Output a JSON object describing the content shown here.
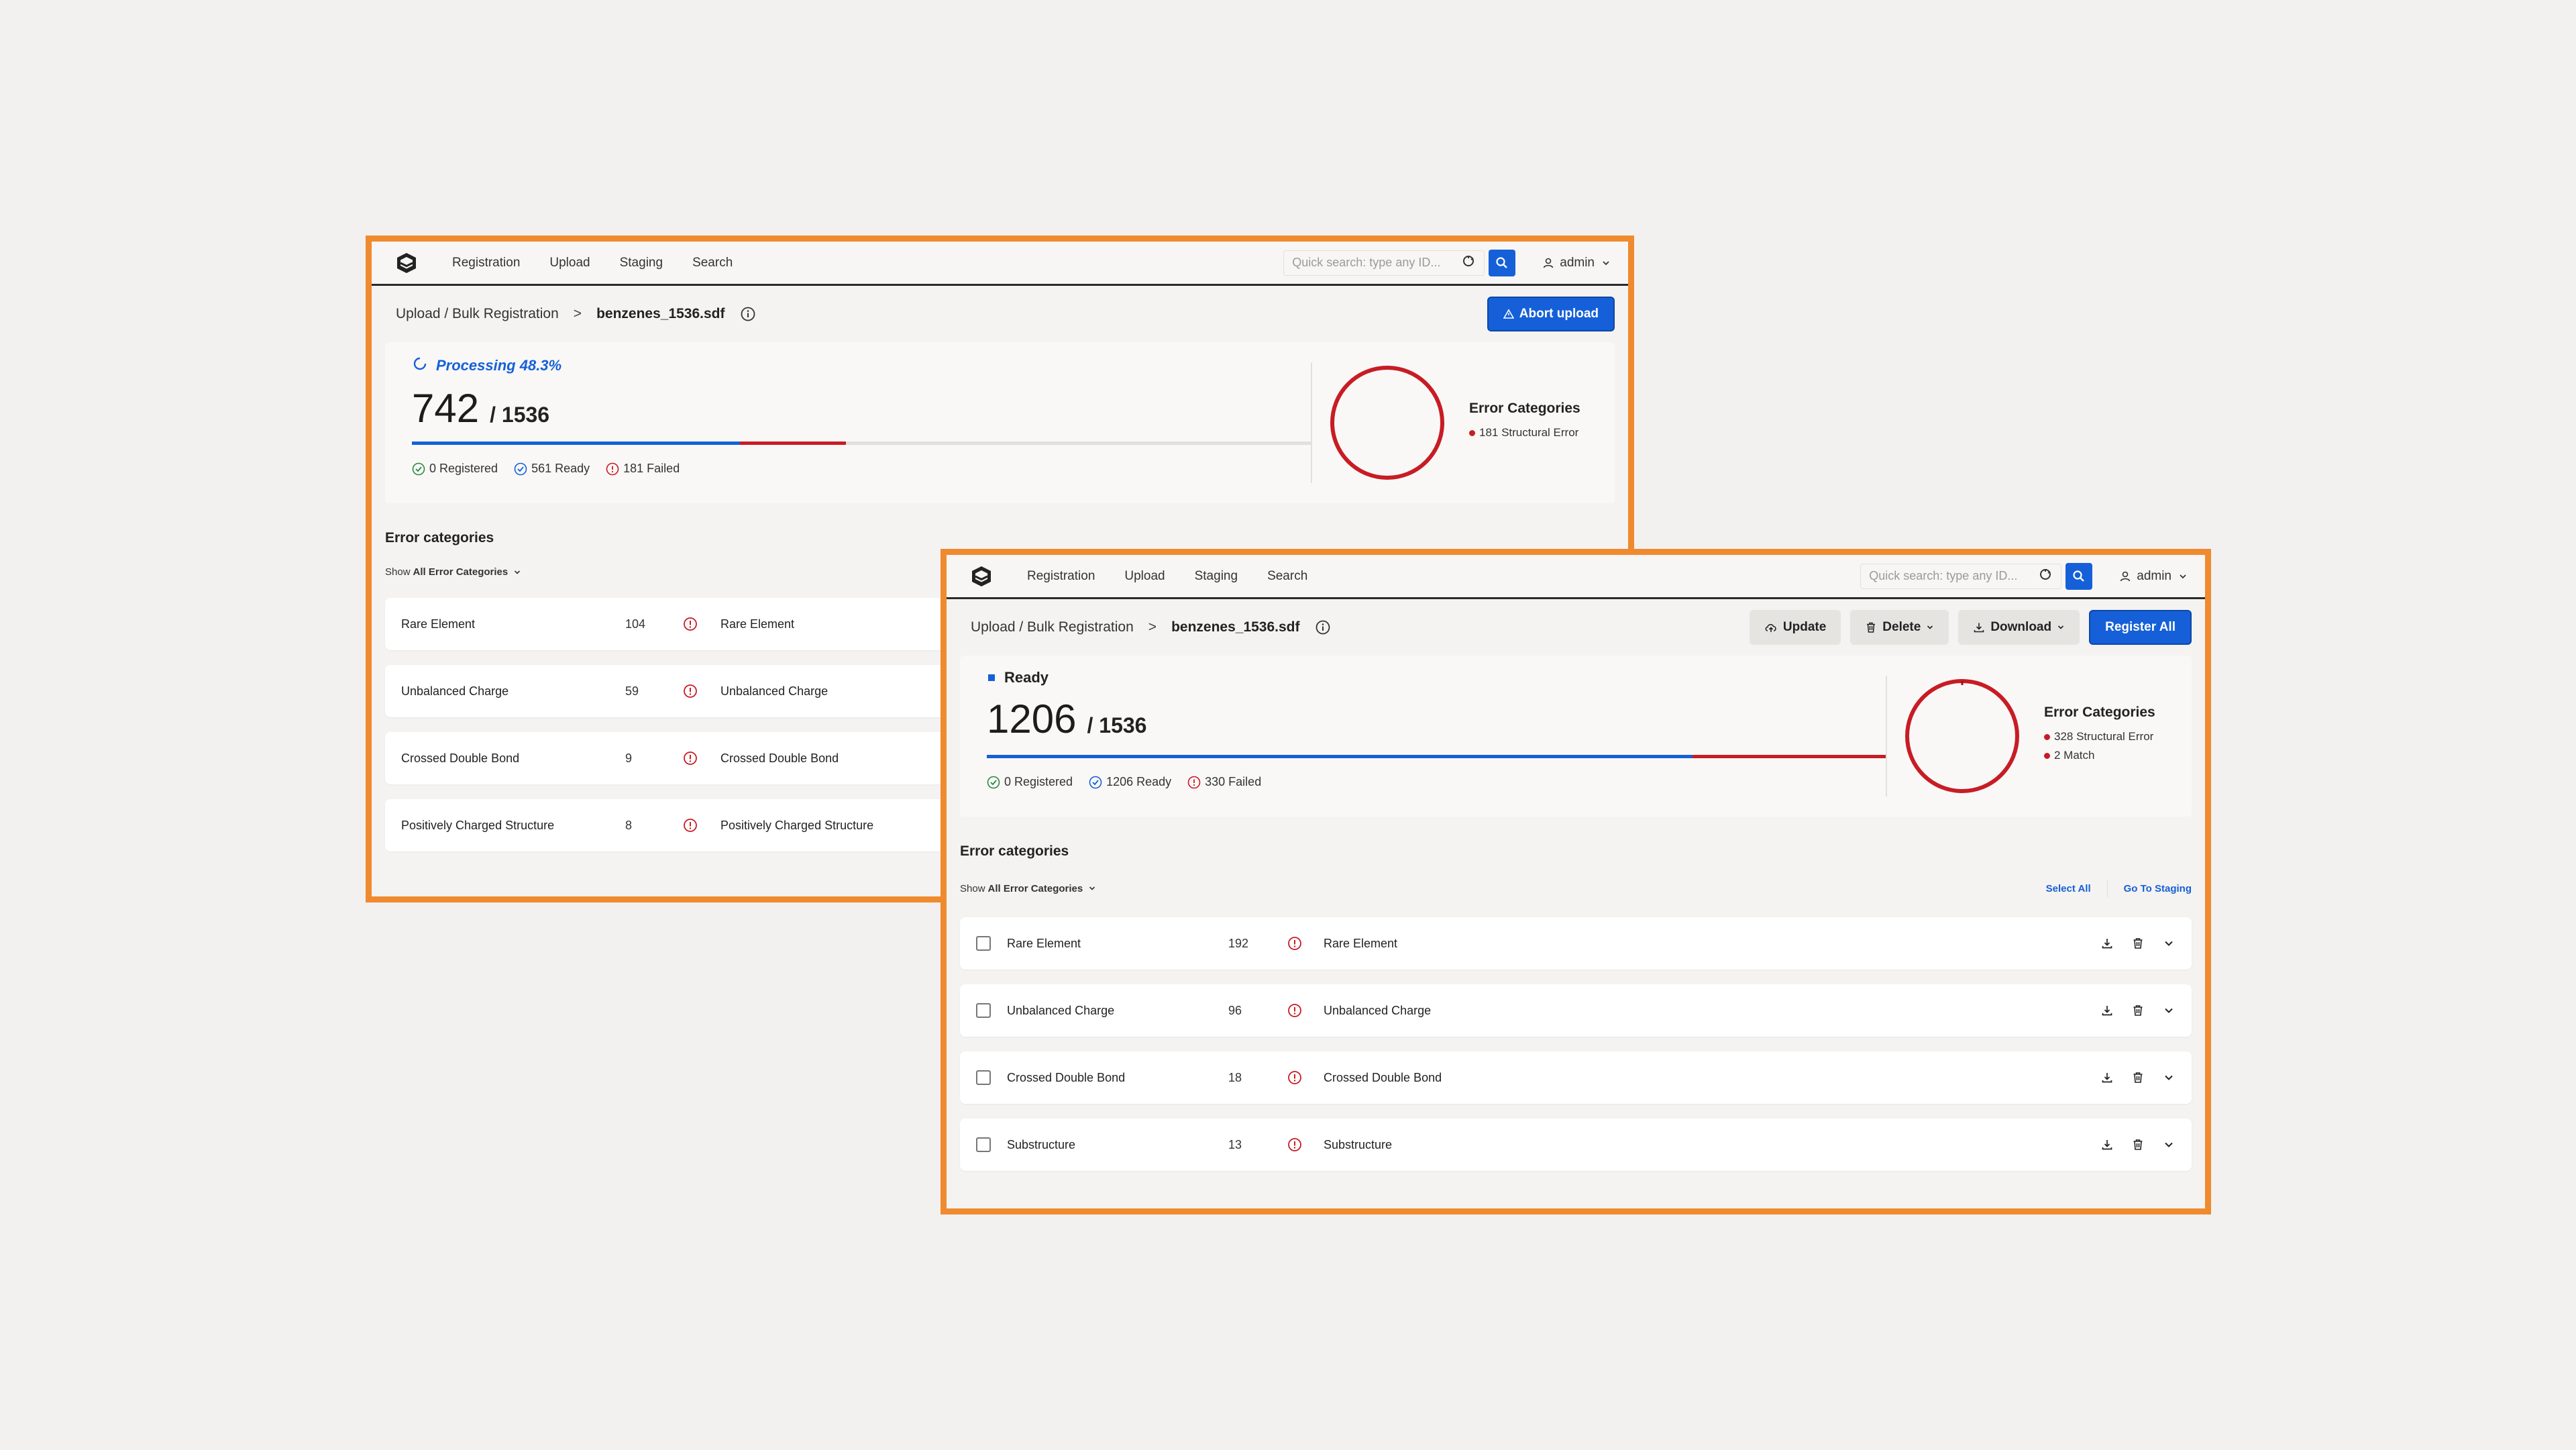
{
  "colors": {
    "accent_orange": "#ef8a2e",
    "primary_blue": "#1560d8",
    "error_red": "#c81c24",
    "success_green": "#2b8a3e",
    "background": "#f3f1ef"
  },
  "screen1": {
    "nav": {
      "items": [
        "Registration",
        "Upload",
        "Staging",
        "Search"
      ],
      "search_placeholder": "Quick search: type any ID...",
      "user": "admin"
    },
    "breadcrumb": {
      "path": "Upload / Bulk Registration",
      "separator": ">",
      "file": "benzenes_1536.sdf"
    },
    "abort_button": "Abort upload",
    "status": {
      "label": "Processing 48.3%",
      "count": "742",
      "total": "/ 1536",
      "progress_blue_fraction": 0.365,
      "progress_red_fraction": 0.118,
      "registered": "0 Registered",
      "ready": "561 Ready",
      "failed": "181 Failed"
    },
    "error_categories_card": {
      "title": "Error Categories",
      "items": [
        "181 Structural Error"
      ]
    },
    "section_title": "Error categories",
    "filter": {
      "prefix": "Show",
      "value": "All Error Categories"
    },
    "rows": [
      {
        "name": "Rare Element",
        "count": "104",
        "label": "Rare Element"
      },
      {
        "name": "Unbalanced Charge",
        "count": "59",
        "label": "Unbalanced Charge"
      },
      {
        "name": "Crossed Double Bond",
        "count": "9",
        "label": "Crossed Double Bond"
      },
      {
        "name": "Positively Charged Structure",
        "count": "8",
        "label": "Positively Charged Structure"
      }
    ]
  },
  "screen2": {
    "nav": {
      "items": [
        "Registration",
        "Upload",
        "Staging",
        "Search"
      ],
      "search_placeholder": "Quick search: type any ID...",
      "user": "admin"
    },
    "breadcrumb": {
      "path": "Upload / Bulk Registration",
      "separator": ">",
      "file": "benzenes_1536.sdf"
    },
    "buttons": {
      "update": "Update",
      "delete": "Delete",
      "download": "Download",
      "register_all": "Register All"
    },
    "status": {
      "label": "Ready",
      "count": "1206",
      "total": "/ 1536",
      "progress_blue_fraction": 0.785,
      "progress_red_fraction": 0.215,
      "registered": "0 Registered",
      "ready": "1206 Ready",
      "failed": "330 Failed"
    },
    "error_categories_card": {
      "title": "Error Categories",
      "items": [
        "328 Structural Error",
        "2 Match"
      ]
    },
    "section_title": "Error categories",
    "filter": {
      "prefix": "Show",
      "value": "All Error Categories"
    },
    "links": {
      "select_all": "Select All",
      "go_to_staging": "Go To Staging"
    },
    "rows": [
      {
        "name": "Rare Element",
        "count": "192",
        "label": "Rare Element"
      },
      {
        "name": "Unbalanced Charge",
        "count": "96",
        "label": "Unbalanced Charge"
      },
      {
        "name": "Crossed Double Bond",
        "count": "18",
        "label": "Crossed Double Bond"
      },
      {
        "name": "Substructure",
        "count": "13",
        "label": "Substructure"
      }
    ]
  }
}
